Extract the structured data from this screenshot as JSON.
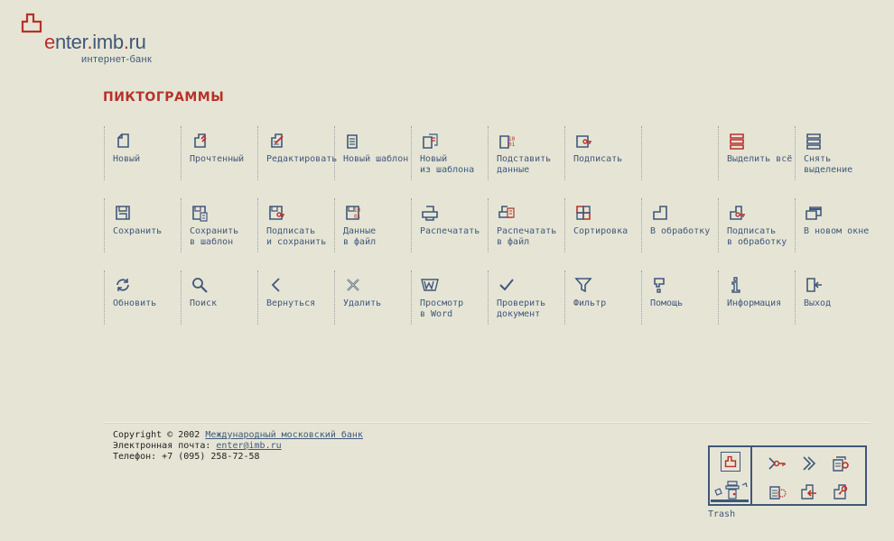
{
  "logo": {
    "pre": "e",
    "mid": "nter",
    "dot1": ".",
    "imb": "imb",
    "dot2": ".",
    "ru": "ru",
    "sub": "интернет-банк"
  },
  "page_title": "ПИКТОГРАММЫ",
  "rows": [
    [
      {
        "label": "Новый",
        "icon": "new-doc-icon"
      },
      {
        "label": "Прочтенный",
        "icon": "read-doc-icon"
      },
      {
        "label": "Редактировать",
        "icon": "edit-doc-icon"
      },
      {
        "label": "Новый шаблон",
        "icon": "new-template-icon"
      },
      {
        "label": "Новый\nиз шаблона",
        "icon": "from-template-icon"
      },
      {
        "label": "Подставить\nданные",
        "icon": "fill-data-icon"
      },
      {
        "label": "Подписать",
        "icon": "sign-icon"
      },
      {
        "label": "",
        "icon": ""
      },
      {
        "label": "Выделить всё",
        "icon": "select-all-icon"
      },
      {
        "label": "Снять\nвыделение",
        "icon": "deselect-icon"
      }
    ],
    [
      {
        "label": "Сохранить",
        "icon": "save-icon"
      },
      {
        "label": "Сохранить\nв шаблон",
        "icon": "save-template-icon"
      },
      {
        "label": "Подписать\nи сохранить",
        "icon": "sign-save-icon"
      },
      {
        "label": "Данные\nв файл",
        "icon": "data-file-icon"
      },
      {
        "label": "Распечатать",
        "icon": "print-icon"
      },
      {
        "label": "Распечатать\nв файл",
        "icon": "print-file-icon"
      },
      {
        "label": "Сортировка",
        "icon": "sort-icon"
      },
      {
        "label": "В обработку",
        "icon": "process-icon"
      },
      {
        "label": "Подписать\nв обработку",
        "icon": "sign-process-icon"
      },
      {
        "label": "В новом окне",
        "icon": "new-window-icon"
      }
    ],
    [
      {
        "label": "Обновить",
        "icon": "refresh-icon"
      },
      {
        "label": "Поиск",
        "icon": "search-icon"
      },
      {
        "label": "Вернуться",
        "icon": "back-icon"
      },
      {
        "label": "Удалить",
        "icon": "delete-icon"
      },
      {
        "label": "Просмотр\nв Word",
        "icon": "word-icon"
      },
      {
        "label": "Проверить\nдокумент",
        "icon": "check-icon"
      },
      {
        "label": "Фильтр",
        "icon": "filter-icon"
      },
      {
        "label": "Помощь",
        "icon": "help-icon"
      },
      {
        "label": "Информация",
        "icon": "info-icon"
      },
      {
        "label": "Выход",
        "icon": "exit-icon"
      }
    ]
  ],
  "footer": {
    "copyright_prefix": "Copyright © 2002 ",
    "copyright_link": "Международный московский банк",
    "email_prefix": "Электронная почта: ",
    "email_link": "enter@imb.ru",
    "phone": "Телефон: +7 (095) 258-72-58"
  },
  "tray": {
    "trash_label": "Trash"
  },
  "colors": {
    "background": "#e6e5d5",
    "blue": "#40577a",
    "red": "#b8302a"
  }
}
